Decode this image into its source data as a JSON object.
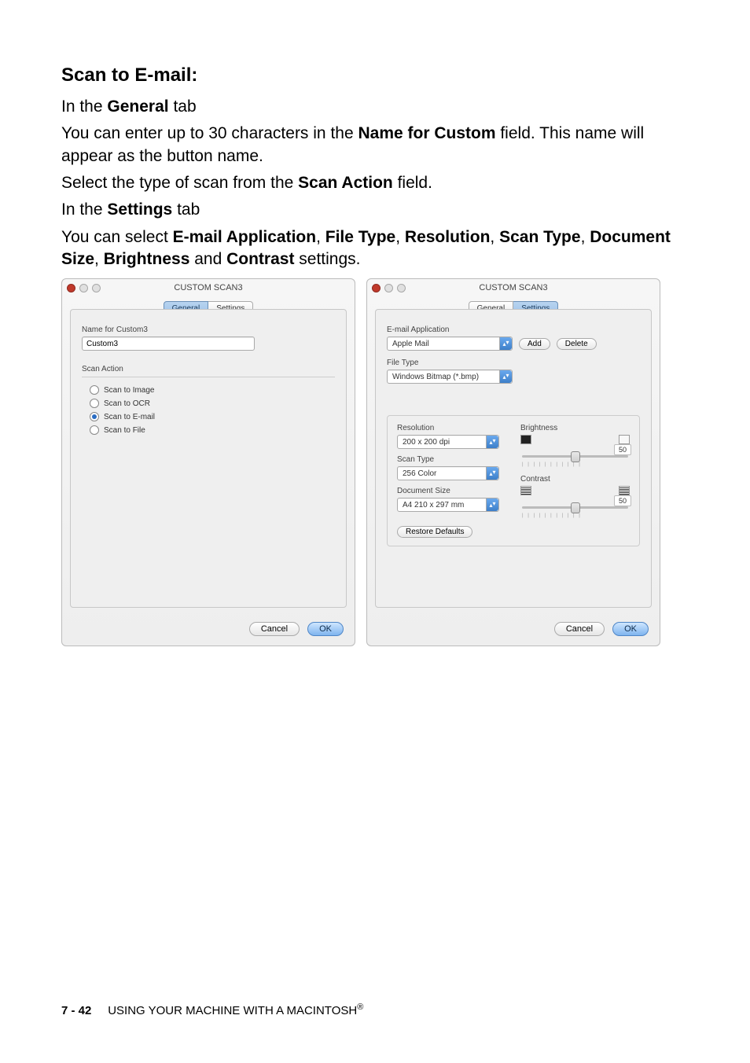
{
  "doc": {
    "title": "Scan to E-mail:",
    "p1_prefix": "In the ",
    "p1_bold": "General",
    "p1_suffix": " tab",
    "p2_prefix": "You can enter up to 30 characters in the ",
    "p2_bold": "Name for Custom",
    "p2_suffix": " field. This name will appear as the button name.",
    "p3_prefix": "Select the type of scan from the ",
    "p3_bold": "Scan Action",
    "p3_suffix": " field.",
    "p4_prefix": "In the ",
    "p4_bold": "Settings",
    "p4_suffix": " tab",
    "p5_prefix": "You can select ",
    "p5_b1": "E-mail Application",
    "p5_s1": ", ",
    "p5_b2": "File Type",
    "p5_s2": ", ",
    "p5_b3": "Resolution",
    "p5_s3": ", ",
    "p5_b4": "Scan Type",
    "p5_s4": ", ",
    "p5_b5": "Document Size",
    "p5_s5": ", ",
    "p5_b6": "Brightness",
    "p5_s6": " and ",
    "p5_b7": "Contrast",
    "p5_suffix": " settings."
  },
  "general": {
    "window_title": "CUSTOM SCAN3",
    "tab_general": "General",
    "tab_settings": "Settings",
    "name_label": "Name for Custom3",
    "name_value": "Custom3",
    "scan_action_label": "Scan Action",
    "radios": {
      "image": "Scan to Image",
      "ocr": "Scan to OCR",
      "email": "Scan to E-mail",
      "file": "Scan to File"
    },
    "cancel": "Cancel",
    "ok": "OK"
  },
  "settings": {
    "window_title": "CUSTOM SCAN3",
    "tab_general": "General",
    "tab_settings": "Settings",
    "email_label": "E-mail Application",
    "email_value": "Apple Mail",
    "add": "Add",
    "delete": "Delete",
    "filetype_label": "File Type",
    "filetype_value": "Windows Bitmap (*.bmp)",
    "resolution_label": "Resolution",
    "resolution_value": "200 x 200 dpi",
    "scantype_label": "Scan Type",
    "scantype_value": "256 Color",
    "docsize_label": "Document Size",
    "docsize_value": "A4 210 x 297 mm",
    "brightness_label": "Brightness",
    "brightness_value": "50",
    "contrast_label": "Contrast",
    "contrast_value": "50",
    "restore": "Restore Defaults",
    "cancel": "Cancel",
    "ok": "OK"
  },
  "footer": {
    "page": "7 - 42",
    "text": "USING YOUR MACHINE WITH A MACINTOSH",
    "reg": "®"
  }
}
